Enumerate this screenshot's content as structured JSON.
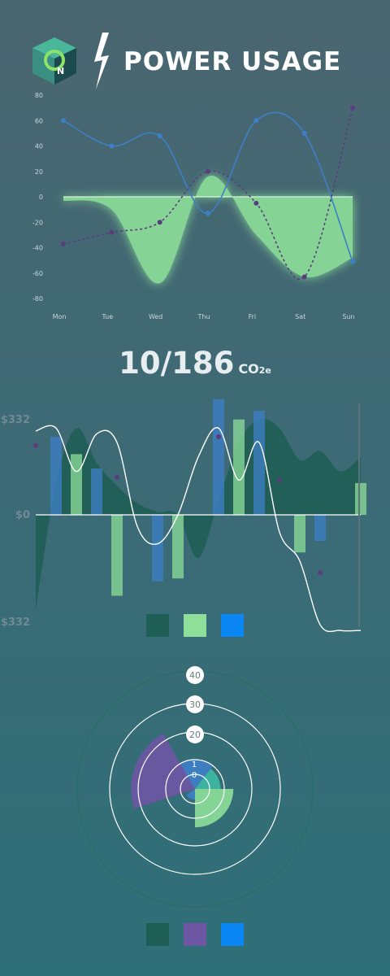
{
  "header": {
    "title": "POWER USAGE",
    "logo_letter": "N",
    "logo_icon": "cube-logo-icon",
    "bolt_icon": "lightning-bolt-icon"
  },
  "colors": {
    "blue": "#3d7fc8",
    "green": "#8ddf99",
    "purple": "#5b3d7e",
    "dark_green": "#1f5e55",
    "bright_blue": "#0a86f5",
    "violet": "#6e55a3"
  },
  "chart_data": [
    {
      "type": "line",
      "categories": [
        "Mon",
        "Tue",
        "Wed",
        "Thu",
        "Fri",
        "Sat",
        "Sun"
      ],
      "y_ticks": [
        "80",
        "60",
        "40",
        "20",
        "0",
        "-20",
        "-40",
        "-60",
        "-80"
      ],
      "ylim": [
        -80,
        80
      ],
      "grid": false,
      "series": [
        {
          "kind": "line",
          "color": "#3d7fc8",
          "values": [
            60,
            40,
            48,
            -13,
            60,
            50,
            -51
          ]
        },
        {
          "kind": "dashed-line",
          "color": "#5b3d7e",
          "values": [
            -37,
            -28,
            -20,
            20,
            -5,
            -63,
            70
          ]
        },
        {
          "kind": "area",
          "color": "#8ddf99",
          "values": [
            -3,
            -10,
            -68,
            16,
            -30,
            -63,
            -48
          ]
        }
      ]
    },
    {
      "type": "bar",
      "metric": {
        "value": "10/186",
        "unit": "CO",
        "subscript": "2e"
      },
      "y_labels": [
        "$332",
        "$0",
        "$332"
      ],
      "ylim": [
        -332,
        332
      ],
      "n": 17,
      "series": [
        {
          "kind": "area",
          "color": "#1f5e55",
          "values": [
            -330,
            110,
            300,
            180,
            100,
            40,
            10,
            0,
            -150,
            50,
            250,
            330,
            300,
            190,
            220,
            150,
            200
          ]
        },
        {
          "kind": "bar",
          "color": "#3d7fc8",
          "values": [
            0,
            270,
            0,
            160,
            0,
            0,
            -230,
            0,
            0,
            400,
            0,
            360,
            0,
            0,
            -90,
            0,
            0
          ]
        },
        {
          "kind": "bar",
          "color": "#8ddf99",
          "values": [
            0,
            0,
            210,
            0,
            -280,
            0,
            0,
            -220,
            0,
            0,
            330,
            0,
            0,
            -130,
            0,
            0,
            110
          ]
        },
        {
          "kind": "line",
          "color": "#ffffff",
          "values": [
            290,
            300,
            150,
            280,
            250,
            -40,
            -100,
            0,
            200,
            300,
            120,
            250,
            -60,
            -160,
            -380,
            -400,
            -400
          ]
        },
        {
          "kind": "points",
          "color": "#5b3d7e",
          "values": [
            240,
            0,
            0,
            0,
            130,
            0,
            0,
            0,
            0,
            270,
            0,
            0,
            120,
            0,
            -200,
            0,
            0
          ]
        }
      ],
      "legend_colors": [
        "#1f5e55",
        "#8ddf99",
        "#0a86f5"
      ]
    },
    {
      "type": "pie",
      "subtype": "polar-area",
      "r_ticks": [
        "40",
        "30",
        "20",
        "1\n0"
      ],
      "rmax": 40,
      "slices": [
        {
          "value": 14,
          "color": "#3d7fc8"
        },
        {
          "value": 12,
          "color": "#3cbaa3"
        },
        {
          "value": 18,
          "color": "#8ddf99"
        },
        {
          "value": 5,
          "color": "#3d7fc8"
        },
        {
          "value": 30,
          "color": "#6e55a3"
        }
      ],
      "legend_colors": [
        "#1f5e55",
        "#6e55a3",
        "#0a86f5"
      ]
    }
  ]
}
